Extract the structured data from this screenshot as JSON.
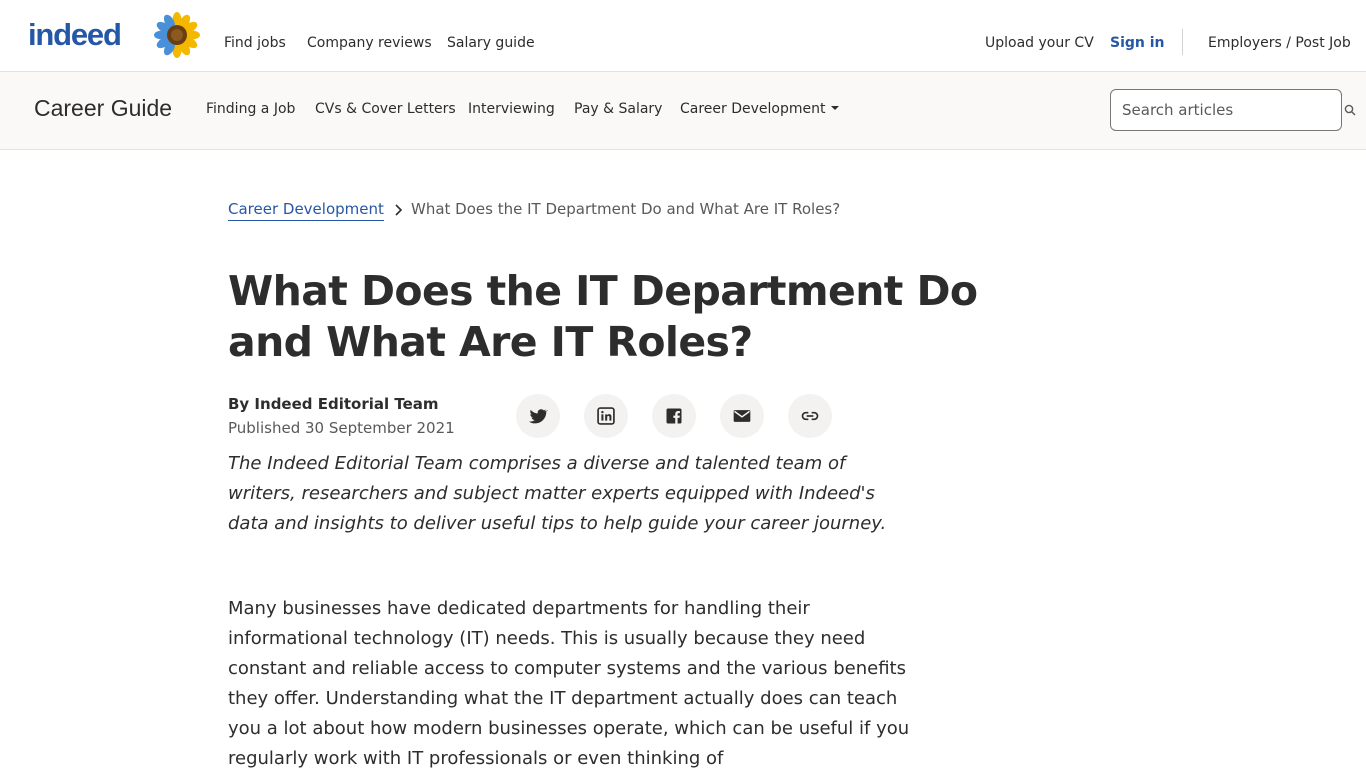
{
  "header": {
    "logo_text": "indeed",
    "nav": [
      {
        "label": "Find jobs"
      },
      {
        "label": "Company reviews"
      },
      {
        "label": "Salary guide"
      }
    ],
    "upload_cv": "Upload your CV",
    "sign_in": "Sign in",
    "employers": "Employers / Post Job"
  },
  "subheader": {
    "title": "Career Guide",
    "nav": [
      {
        "label": "Finding a Job"
      },
      {
        "label": "CVs & Cover Letters"
      },
      {
        "label": "Interviewing"
      },
      {
        "label": "Pay & Salary"
      },
      {
        "label": "Career Development"
      }
    ],
    "search_placeholder": "Search articles"
  },
  "breadcrumb": {
    "parent": "Career Development",
    "current": "What Does the IT Department Do and What Are IT Roles?"
  },
  "article": {
    "title": "What Does the IT Department Do and What Are IT Roles?",
    "author": "By Indeed Editorial Team",
    "published": "Published 30 September 2021",
    "share_icons": [
      "twitter-icon",
      "linkedin-icon",
      "facebook-icon",
      "email-icon",
      "link-icon"
    ],
    "editorial_note": "The Indeed Editorial Team comprises a diverse and talented team of writers, researchers and subject matter experts equipped with Indeed's data and insights to deliver useful tips to help guide your career journey.",
    "intro": "Many businesses have dedicated departments for handling their informational technology (IT) needs. This is usually because they need constant and reliable access to computer systems and the various benefits they offer. Understanding what the IT department actually does can teach you a lot about how modern businesses operate, which can be useful if you regularly work with IT professionals or even thinking of"
  },
  "colors": {
    "brand_blue": "#2557a7",
    "text": "#2d2d2d",
    "muted": "#595959",
    "subbar_bg": "#faf9f8",
    "share_bg": "#f3f2f1"
  }
}
